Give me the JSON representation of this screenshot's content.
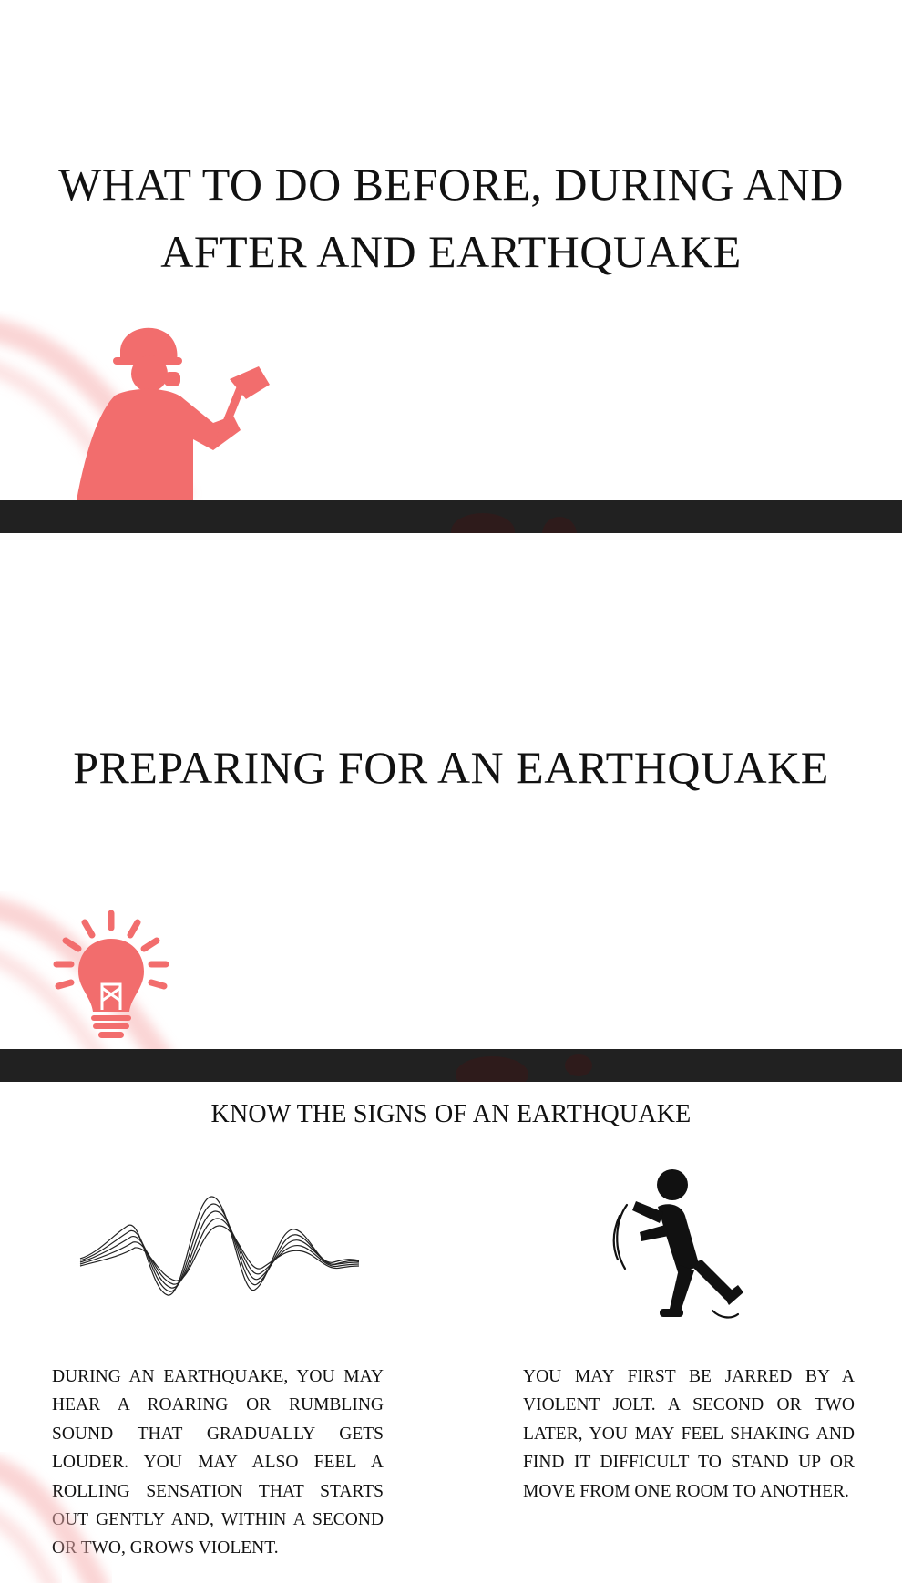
{
  "slides": [
    {
      "title": "WHAT TO DO BEFORE, DURING AND AFTER AND EARTHQUAKE",
      "icon": "firefighter-icon"
    },
    {
      "title": "PREPARING FOR AN EARTHQUAKE",
      "icon": "lightbulb-icon"
    },
    {
      "heading": "KNOW THE SIGNS OF AN EARTHQUAKE",
      "left_icon": "sound-wave-icon",
      "right_icon": "falling-person-icon",
      "left_text": "DURING AN EARTHQUAKE, YOU MAY HEAR A ROARING OR RUMBLING SOUND THAT GRADUALLY GETS LOUDER. YOU MAY ALSO FEEL A ROLLING SENSATION THAT STARTS OUT GENTLY AND, WITHIN A SECOND OR TWO, GROWS VIOLENT.",
      "right_text": "YOU MAY FIRST BE JARRED BY A VIOLENT JOLT. A SECOND OR TWO LATER, YOU MAY FEEL SHAKING AND FIND IT DIFFICULT TO STAND UP OR MOVE FROM ONE ROOM TO ANOTHER."
    }
  ],
  "colors": {
    "accent": "#f26d6d",
    "divider": "#212121",
    "text": "#111111"
  }
}
